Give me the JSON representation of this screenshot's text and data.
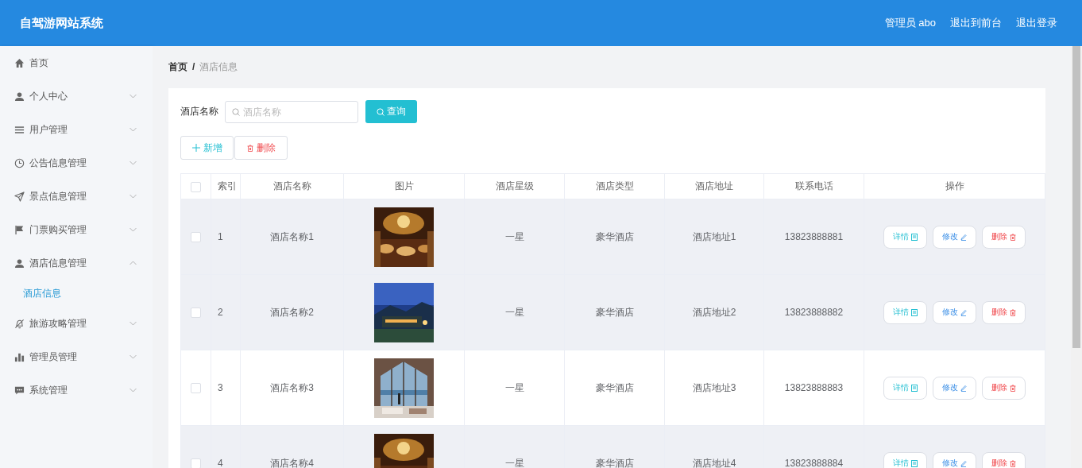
{
  "header": {
    "title": "自驾游网站系统",
    "links": [
      {
        "label": "管理员 abo"
      },
      {
        "label": "退出到前台"
      },
      {
        "label": "退出登录"
      }
    ]
  },
  "sidebar": {
    "items": [
      {
        "label": "首页",
        "kind": "link"
      },
      {
        "label": "个人中心",
        "kind": "menu",
        "expanded": false
      },
      {
        "label": "用户管理",
        "kind": "menu",
        "expanded": false
      },
      {
        "label": "公告信息管理",
        "kind": "menu",
        "expanded": false
      },
      {
        "label": "景点信息管理",
        "kind": "menu",
        "expanded": false
      },
      {
        "label": "门票购买管理",
        "kind": "menu",
        "expanded": false
      },
      {
        "label": "酒店信息管理",
        "kind": "menu",
        "expanded": true,
        "children": [
          {
            "label": "酒店信息",
            "selected": true
          }
        ]
      },
      {
        "label": "旅游攻略管理",
        "kind": "menu",
        "expanded": false
      },
      {
        "label": "管理员管理",
        "kind": "menu",
        "expanded": false
      },
      {
        "label": "系统管理",
        "kind": "menu",
        "expanded": false
      }
    ]
  },
  "breadcrumb": {
    "items": [
      "首页",
      "酒店信息"
    ],
    "separator": "/"
  },
  "search": {
    "label": "酒店名称",
    "placeholder": "酒店名称",
    "button": "查询"
  },
  "toolbar": [
    {
      "label": "新增",
      "kind": "add"
    },
    {
      "label": "删除",
      "kind": "delete"
    }
  ],
  "table": {
    "select_all": {
      "checked": false
    },
    "columns": [
      "索引",
      "酒店名称",
      "图片",
      "酒店星级",
      "酒店类型",
      "酒店地址",
      "联系电话",
      "操作"
    ],
    "rows": [
      {
        "checked": false,
        "shaded": true,
        "index": "1",
        "name": "酒店名称1",
        "star": "一星",
        "type": "豪华酒店",
        "address": "酒店地址1",
        "phone": "13823888881",
        "actions": [
          {
            "label": "详情",
            "kind": "detail"
          },
          {
            "label": "修改",
            "kind": "edit"
          },
          {
            "label": "删除",
            "kind": "delete"
          }
        ]
      },
      {
        "checked": false,
        "shaded": true,
        "index": "2",
        "name": "酒店名称2",
        "star": "一星",
        "type": "豪华酒店",
        "address": "酒店地址2",
        "phone": "13823888882",
        "actions": [
          {
            "label": "详情",
            "kind": "detail"
          },
          {
            "label": "修改",
            "kind": "edit"
          },
          {
            "label": "删除",
            "kind": "delete"
          }
        ]
      },
      {
        "checked": false,
        "shaded": false,
        "index": "3",
        "name": "酒店名称3",
        "star": "一星",
        "type": "豪华酒店",
        "address": "酒店地址3",
        "phone": "13823888883",
        "actions": [
          {
            "label": "详情",
            "kind": "detail"
          },
          {
            "label": "修改",
            "kind": "edit"
          },
          {
            "label": "删除",
            "kind": "delete"
          }
        ]
      },
      {
        "checked": false,
        "shaded": true,
        "index": "4",
        "name": "酒店名称4",
        "star": "一星",
        "type": "豪华酒店",
        "address": "酒店地址4",
        "phone": "13823888884",
        "actions": [
          {
            "label": "详情",
            "kind": "detail"
          },
          {
            "label": "修改",
            "kind": "edit"
          },
          {
            "label": "删除",
            "kind": "delete"
          }
        ]
      }
    ]
  }
}
